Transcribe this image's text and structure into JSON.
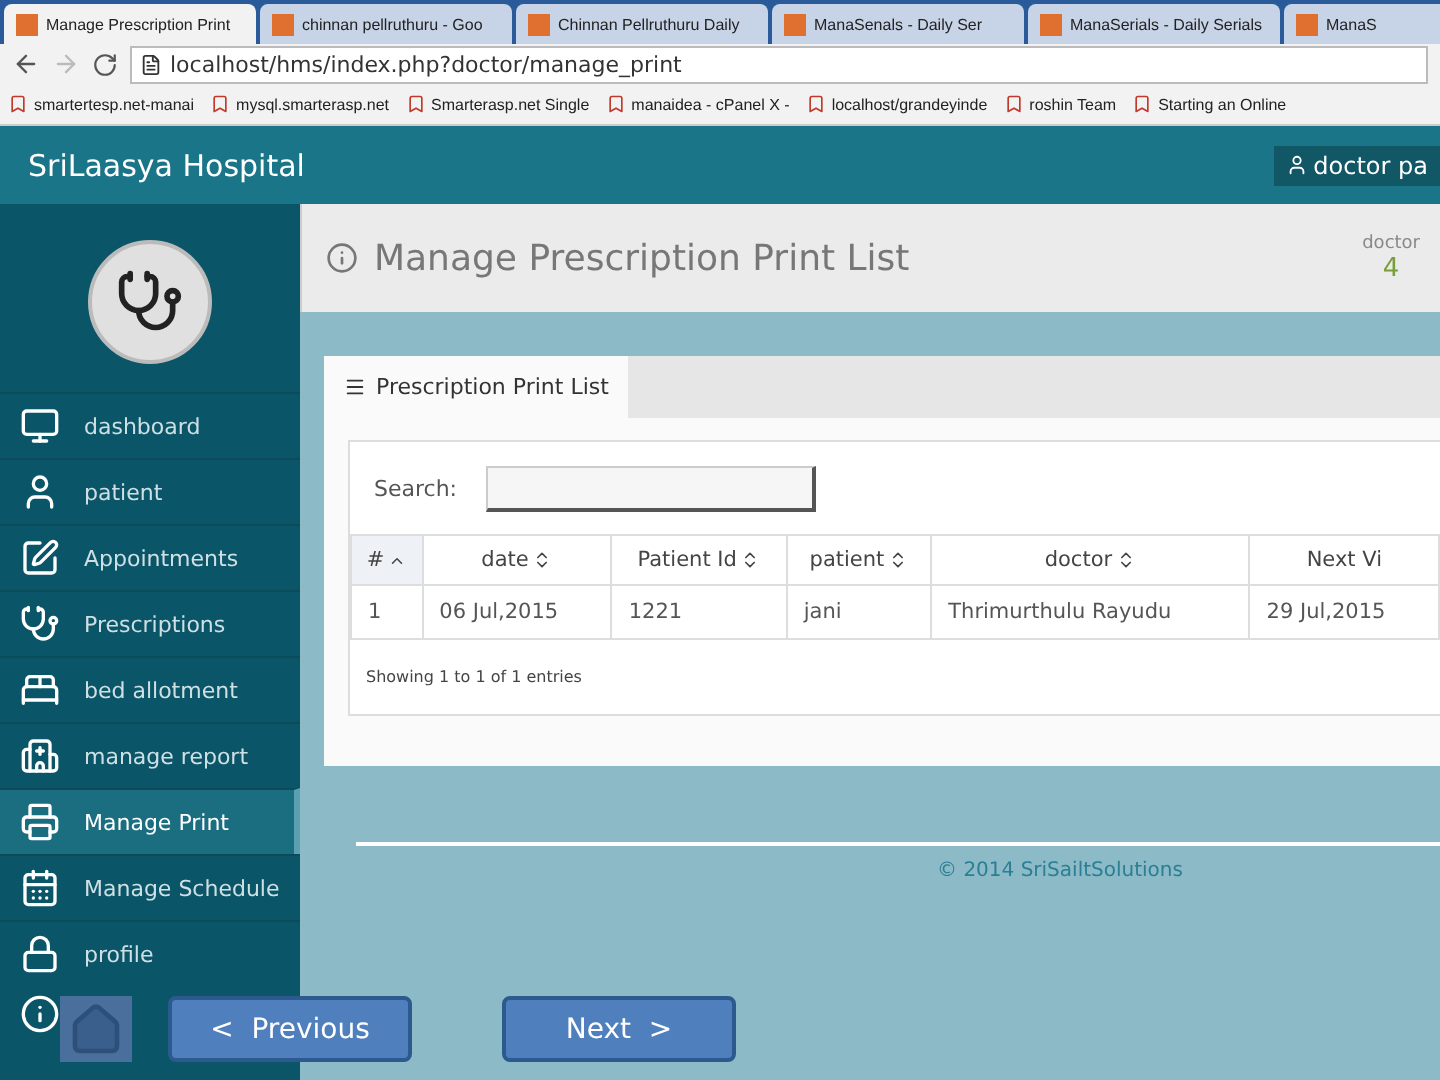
{
  "browser": {
    "tabs": [
      {
        "title": "Manage Prescription Print",
        "selected": true
      },
      {
        "title": "chinnan pellruthuru - Goo",
        "selected": false
      },
      {
        "title": "Chinnan Pellruthuru Daily",
        "selected": false
      },
      {
        "title": "ManaSenals - Daily Ser",
        "selected": false
      },
      {
        "title": "ManaSerials - Daily Serials",
        "selected": false
      },
      {
        "title": "ManaS",
        "selected": false
      }
    ],
    "address": "localhost/hms/index.php?doctor/manage_print",
    "bookmarks": [
      "smartertesp.net-manai",
      "mysql.smarterasp.net",
      "Smarterasp.net Single",
      "manaidea - cPanel X -",
      "localhost/grandeyinde",
      "roshin Team",
      "Starting an Online"
    ]
  },
  "app": {
    "brand": "SriLaasya Hospital",
    "user": "doctor pa"
  },
  "sidebar": {
    "items": [
      {
        "label": "dashboard",
        "selected": false
      },
      {
        "label": "patient",
        "selected": false
      },
      {
        "label": "Appointments",
        "selected": false
      },
      {
        "label": "Prescriptions",
        "selected": false
      },
      {
        "label": "bed allotment",
        "selected": false
      },
      {
        "label": "manage report",
        "selected": false
      },
      {
        "label": "Manage Print",
        "selected": true
      },
      {
        "label": "Manage Schedule",
        "selected": false
      },
      {
        "label": "profile",
        "selected": false
      }
    ]
  },
  "page": {
    "title": "Manage Prescription Print List",
    "role_label": "doctor",
    "role_count": "4"
  },
  "panel": {
    "tab": "Prescription Print List",
    "search_label": "Search:",
    "table": {
      "columns": [
        "#",
        "date",
        "Patient Id",
        "patient",
        "doctor",
        "Next Vi"
      ],
      "rows": [
        [
          "1",
          "06 Jul,2015",
          "1221",
          "jani",
          "Thrimurthulu Rayudu",
          "29 Jul,2015"
        ]
      ]
    },
    "info": "Showing 1 to 1 of 1 entries"
  },
  "footer": "© 2014 SriSailtSolutions",
  "slide_nav": {
    "previous": "<  Previous",
    "next": "Next  >"
  }
}
